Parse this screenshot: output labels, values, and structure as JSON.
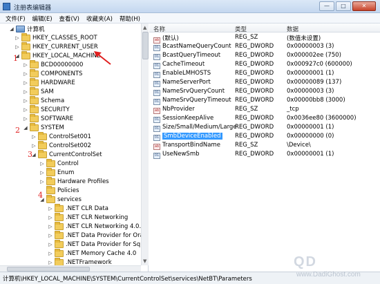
{
  "window": {
    "title": "注册表编辑器",
    "controls": [
      "—",
      "□",
      "✕"
    ]
  },
  "menu": [
    "文件(F)",
    "编辑(E)",
    "查看(V)",
    "收藏夹(A)",
    "帮助(H)"
  ],
  "tree": [
    {
      "label": "计算机",
      "expander": "◢",
      "icon": "computer"
    },
    {
      "label": "HKEY_CLASSES_ROOT",
      "expander": "▷",
      "icon": "folder"
    },
    {
      "label": "HKEY_CURRENT_USER",
      "expander": "▷",
      "icon": "folder"
    },
    {
      "label": "HKEY_LOCAL_MACHINE",
      "expander": "◢",
      "icon": "folder"
    },
    {
      "label": "BCD00000000",
      "expander": "▷",
      "icon": "folder"
    },
    {
      "label": "COMPONENTS",
      "expander": "▷",
      "icon": "folder"
    },
    {
      "label": "HARDWARE",
      "expander": "▷",
      "icon": "folder"
    },
    {
      "label": "SAM",
      "expander": "▷",
      "icon": "folder"
    },
    {
      "label": "Schema",
      "expander": "▷",
      "icon": "folder"
    },
    {
      "label": "SECURITY",
      "expander": "▷",
      "icon": "folder"
    },
    {
      "label": "SOFTWARE",
      "expander": "▷",
      "icon": "folder"
    },
    {
      "label": "SYSTEM",
      "expander": "◢",
      "icon": "folder"
    },
    {
      "label": "ControlSet001",
      "expander": "▷",
      "icon": "folder"
    },
    {
      "label": "ControlSet002",
      "expander": "▷",
      "icon": "folder"
    },
    {
      "label": "CurrentControlSet",
      "expander": "◢",
      "icon": "folder"
    },
    {
      "label": "Control",
      "expander": "▷",
      "icon": "folder"
    },
    {
      "label": "Enum",
      "expander": "▷",
      "icon": "folder"
    },
    {
      "label": "Hardware Profiles",
      "expander": "▷",
      "icon": "folder"
    },
    {
      "label": "Policies",
      "expander": "",
      "icon": "folder"
    },
    {
      "label": "services",
      "expander": "◢",
      "icon": "folder"
    },
    {
      "label": ".NET CLR Data",
      "expander": "▷",
      "icon": "folder"
    },
    {
      "label": ".NET CLR Networking",
      "expander": "▷",
      "icon": "folder"
    },
    {
      "label": ".NET CLR Networking 4.0.0.0",
      "expander": "▷",
      "icon": "folder"
    },
    {
      "label": ".NET Data Provider for Oracle",
      "expander": "▷",
      "icon": "folder"
    },
    {
      "label": ".NET Data Provider for SqlServer",
      "expander": "▷",
      "icon": "folder"
    },
    {
      "label": ".NET Memory Cache 4.0",
      "expander": "▷",
      "icon": "folder"
    },
    {
      "label": ".NETFramework",
      "expander": "▷",
      "icon": "folder"
    }
  ],
  "annotations": [
    "1",
    "2",
    "3",
    "4"
  ],
  "columns": {
    "name": "名称",
    "type": "类型",
    "data": "数据"
  },
  "values": [
    {
      "name": "(默认)",
      "type": "REG_SZ",
      "data": "(数值未设置)",
      "icon": "ab"
    },
    {
      "name": "BcastNameQueryCount",
      "type": "REG_DWORD",
      "data": "0x00000003 (3)",
      "icon": "01"
    },
    {
      "name": "BcastQueryTimeout",
      "type": "REG_DWORD",
      "data": "0x000002ee (750)",
      "icon": "01"
    },
    {
      "name": "CacheTimeout",
      "type": "REG_DWORD",
      "data": "0x000927c0 (600000)",
      "icon": "01"
    },
    {
      "name": "EnableLMHOSTS",
      "type": "REG_DWORD",
      "data": "0x00000001 (1)",
      "icon": "01"
    },
    {
      "name": "NameServerPort",
      "type": "REG_DWORD",
      "data": "0x00000089 (137)",
      "icon": "01"
    },
    {
      "name": "NameSrvQueryCount",
      "type": "REG_DWORD",
      "data": "0x00000003 (3)",
      "icon": "01"
    },
    {
      "name": "NameSrvQueryTimeout",
      "type": "REG_DWORD",
      "data": "0x00000bb8 (3000)",
      "icon": "01"
    },
    {
      "name": "NbProvider",
      "type": "REG_SZ",
      "data": "_tcp",
      "icon": "ab"
    },
    {
      "name": "SessionKeepAlive",
      "type": "REG_DWORD",
      "data": "0x0036ee80 (3600000)",
      "icon": "01"
    },
    {
      "name": "Size/Small/Medium/Large",
      "type": "REG_DWORD",
      "data": "0x00000001 (1)",
      "icon": "01"
    },
    {
      "name": "SmbDeviceEnabled",
      "type": "REG_DWORD",
      "data": "0x00000000 (0)",
      "icon": "01",
      "selected": true
    },
    {
      "name": "TransportBindName",
      "type": "REG_SZ",
      "data": "\\Device\\",
      "icon": "ab"
    },
    {
      "name": "UseNewSmb",
      "type": "REG_DWORD",
      "data": "0x00000001 (1)",
      "icon": "01"
    }
  ],
  "status": "计算机\\HKEY_LOCAL_MACHINE\\SYSTEM\\CurrentControlSet\\services\\NetBT\\Parameters",
  "watermark": {
    "big": "QD",
    "small": "www.DadiGhost.com"
  }
}
